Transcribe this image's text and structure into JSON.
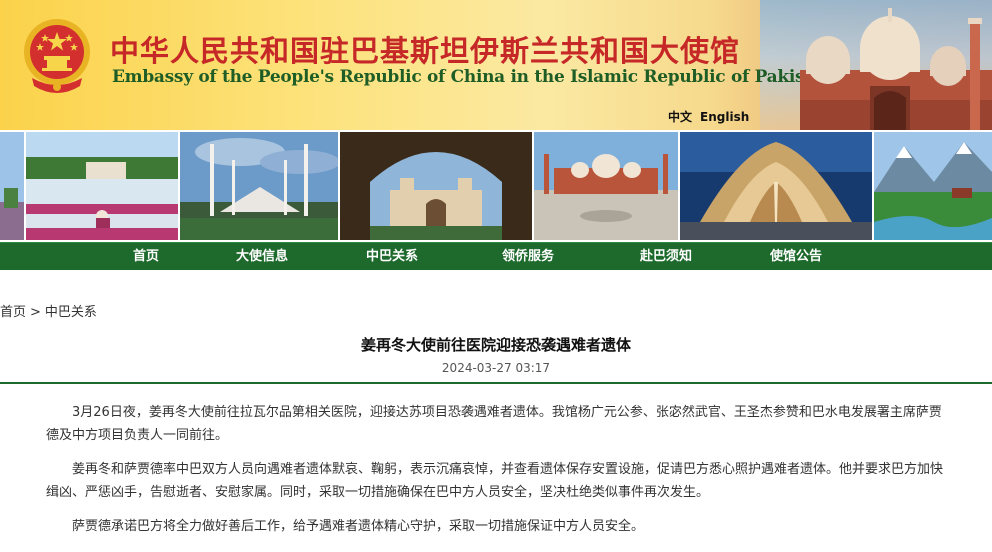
{
  "header": {
    "title_cn": "中华人民共和国驻巴基斯坦伊斯兰共和国大使馆",
    "title_en": "Embassy of the People's Republic of China in the Islamic Republic of Pakistan",
    "lang_cn": "中文",
    "lang_en": "English"
  },
  "nav": {
    "items": [
      "首页",
      "大使信息",
      "中巴关系",
      "领侨服务",
      "赴巴须知",
      "使馆公告"
    ]
  },
  "breadcrumb": {
    "home": "首页",
    "sep": ">",
    "current": "中巴关系"
  },
  "article": {
    "title": "姜再冬大使前往医院迎接恐袭遇难者遗体",
    "date": "2024-03-27 03:17",
    "paragraphs": [
      "3月26日夜，姜再冬大使前往拉瓦尔品第相关医院，迎接达苏项目恐袭遇难者遗体。我馆杨广元公参、张宓然武官、王圣杰参赞和巴水电发展署主席萨贾德及中方项目负责人一同前往。",
      "姜再冬和萨贾德率中巴双方人员向遇难者遗体默哀、鞠躬，表示沉痛哀悼，并查看遗体保存安置设施，促请巴方悉心照护遇难者遗体。他并要求巴方加快缉凶、严惩凶手，告慰逝者、安慰家属。同时，采取一切措施确保在巴中方人员安全，坚决杜绝类似事件再次发生。",
      "萨贾德承诺巴方将全力做好善后工作，给予遇难者遗体精心守护，采取一切措施保证中方人员安全。"
    ]
  },
  "colors": {
    "nav_bg": "#1d6a2c",
    "title_red": "#c62828",
    "title_green": "#1f5d26"
  }
}
